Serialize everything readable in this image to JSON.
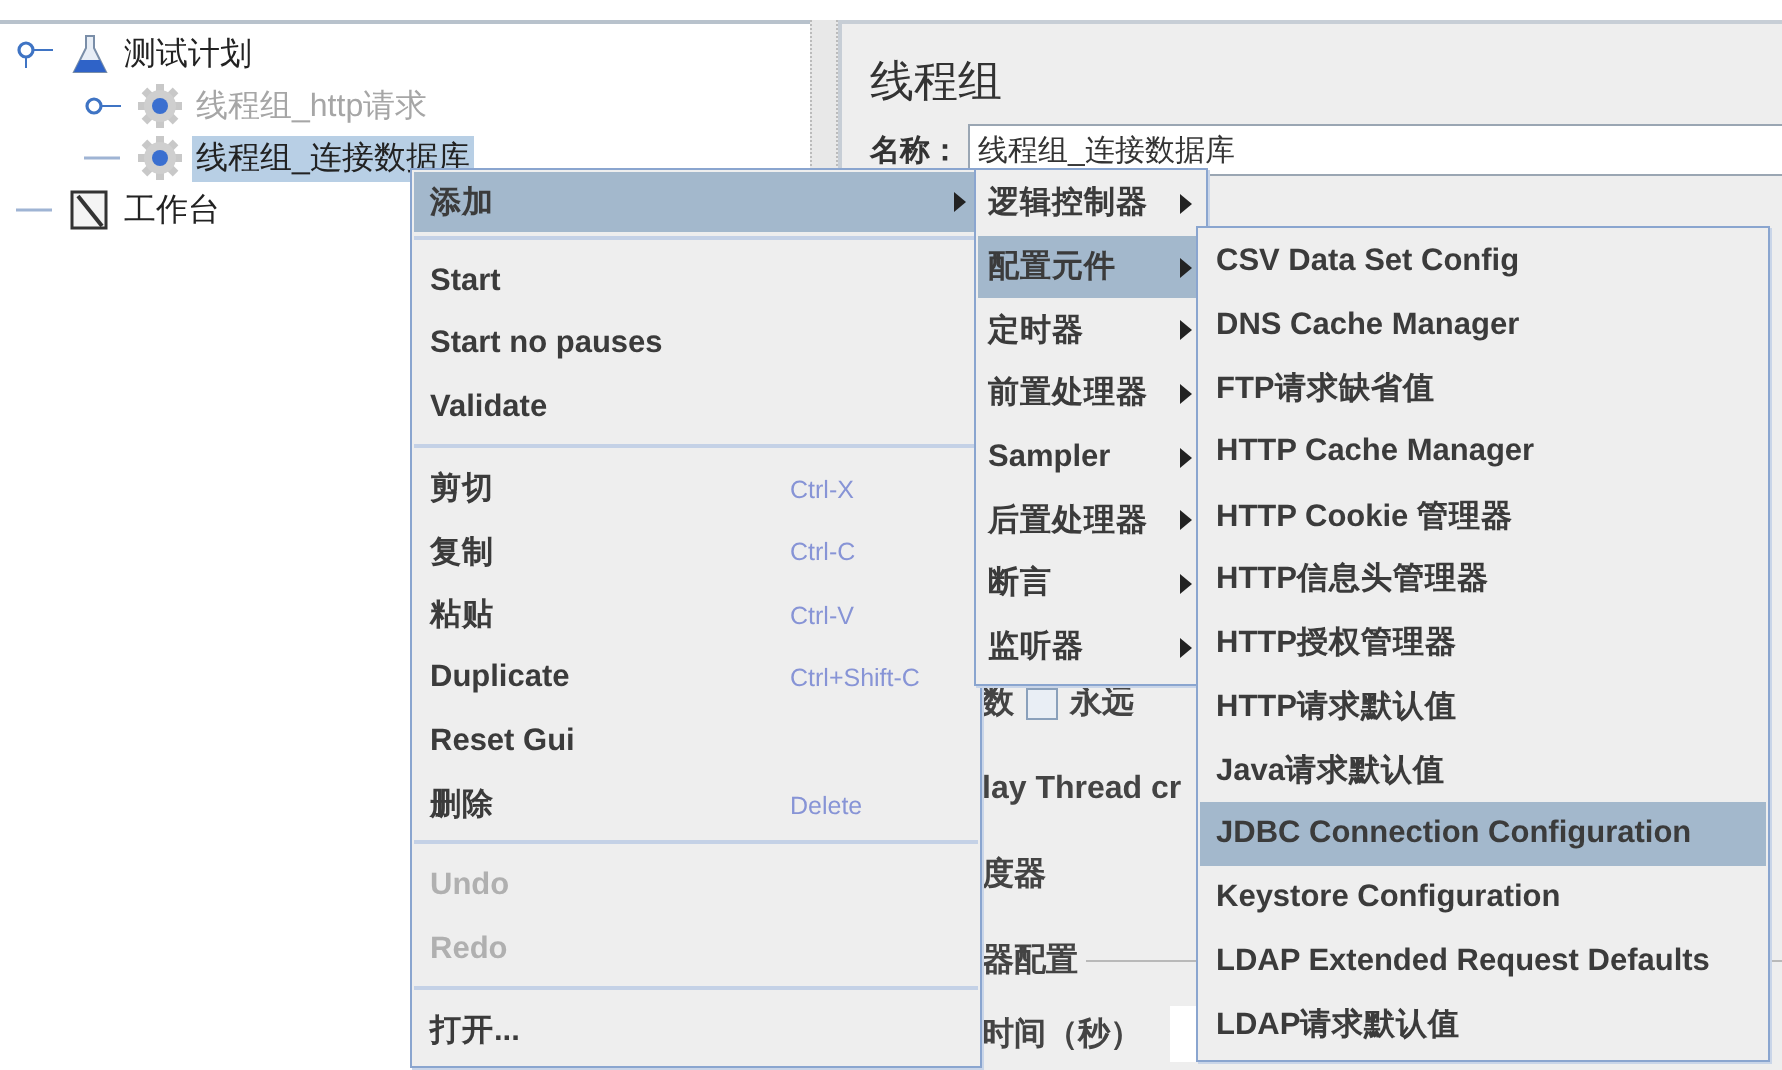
{
  "tree": [
    {
      "label": "测试计划",
      "kind": "test-plan",
      "expanded": true,
      "disabled": false,
      "selected": false,
      "children": [
        {
          "label": "线程组_http请求",
          "kind": "thread-group",
          "expanded": false,
          "disabled": true,
          "selected": false
        },
        {
          "label": "线程组_连接数据库",
          "kind": "thread-group",
          "disabled": false,
          "selected": true
        }
      ]
    },
    {
      "label": "工作台",
      "kind": "workbench",
      "disabled": false,
      "selected": false
    }
  ],
  "panel": {
    "title": "线程组",
    "name_label": "名称：",
    "name_value": "线程组_连接数据库",
    "fragments": [
      {
        "kind": "checkbox-row",
        "text": "数",
        "checked": false,
        "label": "永远"
      },
      {
        "kind": "text",
        "text": "lay Thread cr"
      },
      {
        "kind": "text",
        "text": "度器"
      },
      {
        "kind": "group-title",
        "text": "器配置"
      },
      {
        "kind": "field-row",
        "text": "时间（秒）"
      }
    ]
  },
  "context_menu": {
    "groups": [
      [
        {
          "label": "添加",
          "kind": "submenu",
          "selected": true,
          "disabled": false
        }
      ],
      [
        {
          "label": "Start",
          "kind": "action",
          "selected": false,
          "disabled": false
        },
        {
          "label": "Start no pauses",
          "kind": "action",
          "selected": false,
          "disabled": false
        },
        {
          "label": "Validate",
          "kind": "action",
          "selected": false,
          "disabled": false
        }
      ],
      [
        {
          "label": "剪切",
          "kind": "action",
          "shortcut": "Ctrl-X",
          "selected": false,
          "disabled": false
        },
        {
          "label": "复制",
          "kind": "action",
          "shortcut": "Ctrl-C",
          "selected": false,
          "disabled": false
        },
        {
          "label": "粘贴",
          "kind": "action",
          "shortcut": "Ctrl-V",
          "selected": false,
          "disabled": false
        },
        {
          "label": "Duplicate",
          "kind": "action",
          "shortcut": "Ctrl+Shift-C",
          "selected": false,
          "disabled": false
        },
        {
          "label": "Reset Gui",
          "kind": "action",
          "selected": false,
          "disabled": false
        },
        {
          "label": "删除",
          "kind": "action",
          "shortcut": "Delete",
          "selected": false,
          "disabled": false
        }
      ],
      [
        {
          "label": "Undo",
          "kind": "action",
          "selected": false,
          "disabled": true
        },
        {
          "label": "Redo",
          "kind": "action",
          "selected": false,
          "disabled": true
        }
      ],
      [
        {
          "label": "打开...",
          "kind": "action",
          "selected": false,
          "disabled": false
        }
      ]
    ]
  },
  "add_submenu": {
    "items": [
      {
        "label": "逻辑控制器",
        "kind": "submenu",
        "selected": false
      },
      {
        "label": "配置元件",
        "kind": "submenu",
        "selected": true
      },
      {
        "label": "定时器",
        "kind": "submenu",
        "selected": false
      },
      {
        "label": "前置处理器",
        "kind": "submenu",
        "selected": false
      },
      {
        "label": "Sampler",
        "kind": "submenu",
        "selected": false
      },
      {
        "label": "后置处理器",
        "kind": "submenu",
        "selected": false
      },
      {
        "label": "断言",
        "kind": "submenu",
        "selected": false
      },
      {
        "label": "监听器",
        "kind": "submenu",
        "selected": false
      }
    ]
  },
  "config_submenu": {
    "items": [
      {
        "label": "CSV Data Set Config",
        "selected": false
      },
      {
        "label": "DNS Cache Manager",
        "selected": false
      },
      {
        "label": "FTP请求缺省值",
        "selected": false
      },
      {
        "label": "HTTP Cache Manager",
        "selected": false
      },
      {
        "label": "HTTP Cookie 管理器",
        "selected": false
      },
      {
        "label": "HTTP信息头管理器",
        "selected": false
      },
      {
        "label": "HTTP授权管理器",
        "selected": false
      },
      {
        "label": "HTTP请求默认值",
        "selected": false
      },
      {
        "label": "Java请求默认值",
        "selected": false
      },
      {
        "label": "JDBC Connection Configuration",
        "selected": true
      },
      {
        "label": "Keystore Configuration",
        "selected": false
      },
      {
        "label": "LDAP Extended Request Defaults",
        "selected": false
      },
      {
        "label": "LDAP请求默认值",
        "selected": false
      }
    ]
  }
}
